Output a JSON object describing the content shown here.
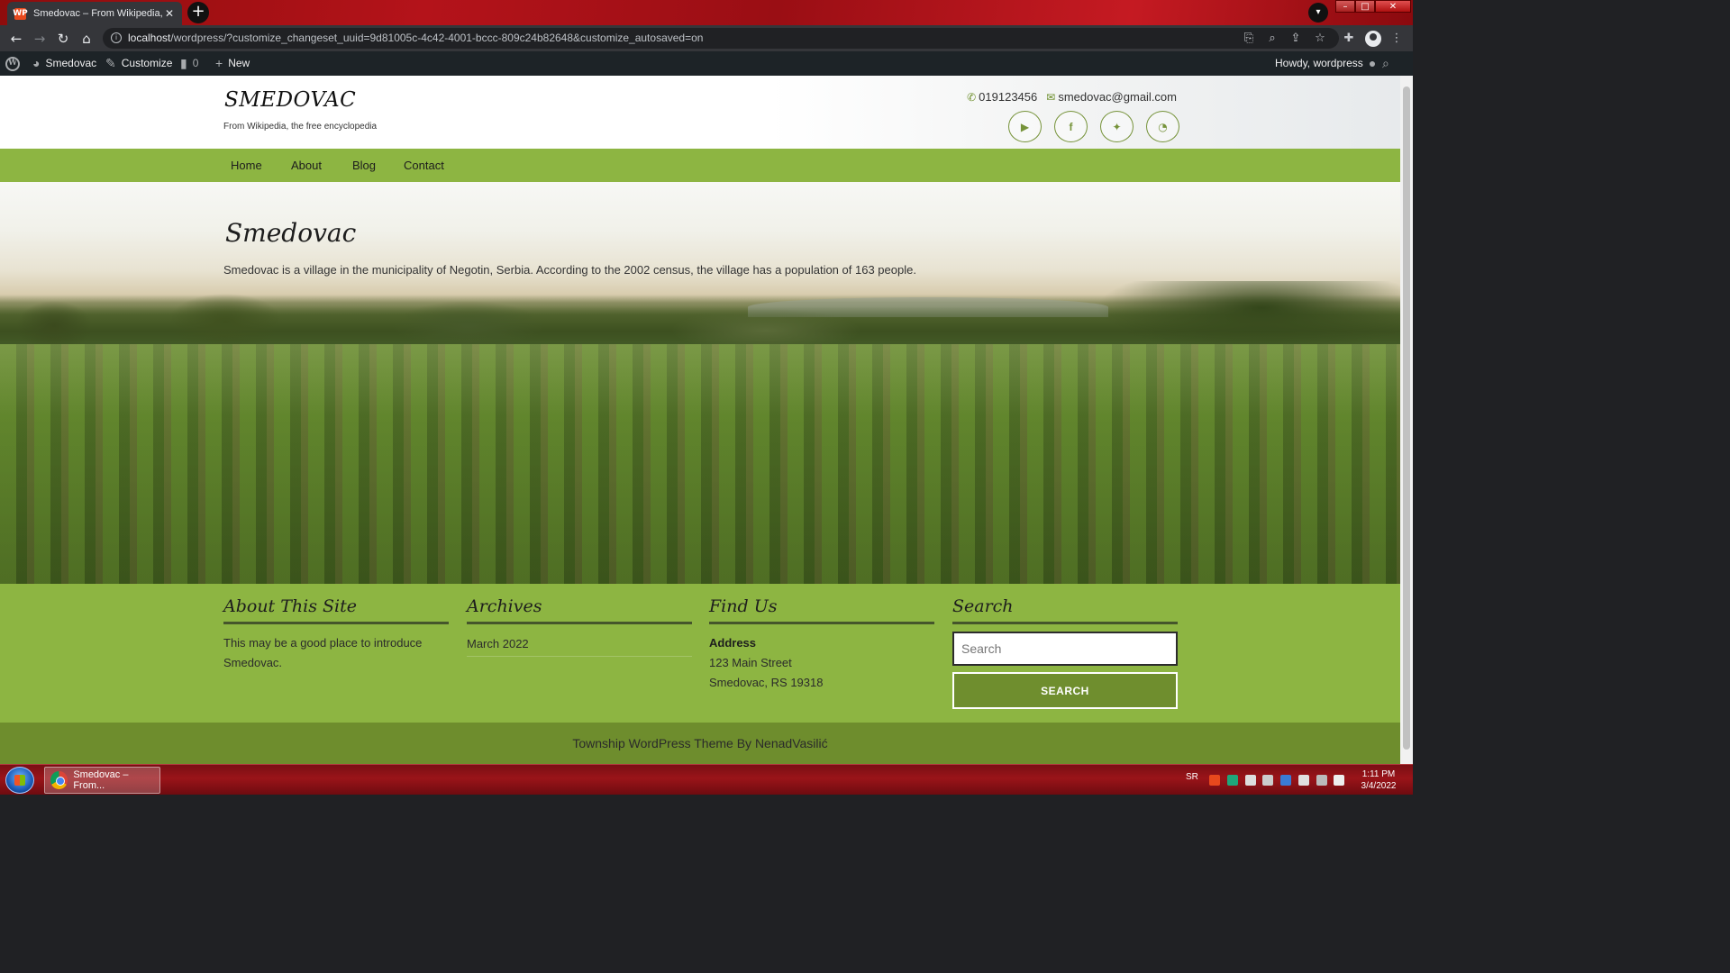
{
  "browser": {
    "tab_title": "Smedovac – From Wikipedia, the",
    "tab_favicon": "WP",
    "tab_close": "✕",
    "new_tab": "+",
    "url_host": "localhost",
    "url_path": "/wordpress/?customize_changeset_uuid=9d81005c-4c42-4001-bccc-809c24b82648&customize_autosaved=on"
  },
  "adminbar": {
    "site_name": "Smedovac",
    "customize": "Customize",
    "comments_count": "0",
    "new": "New",
    "howdy": "Howdy, wordpress"
  },
  "site": {
    "title": "SMEDOVAC",
    "tagline": "From Wikipedia, the free encyclopedia",
    "phone": "019123456",
    "email": "smedovac@gmail.com",
    "socials": [
      "youtube-icon",
      "facebook-icon",
      "twitter-icon",
      "rss-icon"
    ]
  },
  "nav": {
    "items": [
      {
        "label": "Home"
      },
      {
        "label": "About"
      },
      {
        "label": "Blog"
      },
      {
        "label": "Contact"
      }
    ]
  },
  "hero": {
    "title": "Smedovac",
    "text": "Smedovac is a village in the municipality of Negotin, Serbia. According to the 2002 census, the village has a population of 163 people."
  },
  "widgets": {
    "about": {
      "title": "About This Site",
      "text": "This may be a good place to introduce Smedovac."
    },
    "archives": {
      "title": "Archives",
      "items": [
        "March 2022"
      ]
    },
    "find_us": {
      "title": "Find Us",
      "label": "Address",
      "line1": "123 Main Street",
      "line2": "Smedovac, RS 19318"
    },
    "search": {
      "title": "Search",
      "placeholder": "Search",
      "button": "SEARCH"
    }
  },
  "footer": {
    "credit": "Township WordPress Theme By NenadVasilić"
  },
  "taskbar": {
    "task_label": "Smedovac – From...",
    "lang": "SR",
    "time": "1:11 PM",
    "date": "3/4/2022"
  },
  "colors": {
    "accent_green": "#8db542",
    "footer_green": "#6e8d2d",
    "admin_bar": "#1d2327"
  }
}
